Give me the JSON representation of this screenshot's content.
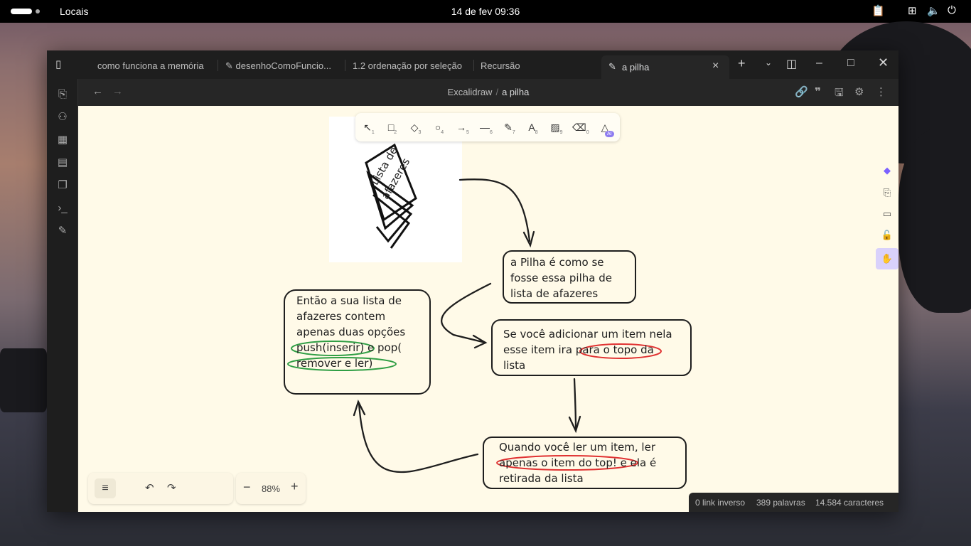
{
  "system": {
    "places": "Locais",
    "clock": "14 de fev  09:36"
  },
  "tabs": [
    {
      "label": "como funciona a memória",
      "icon": "file-icon"
    },
    {
      "label": "desenhoComoFuncio...",
      "icon": "excalidraw-icon"
    },
    {
      "label": "1.2 ordenação por seleção",
      "icon": "file-icon"
    },
    {
      "label": "Recursão",
      "icon": "file-icon"
    }
  ],
  "active_tab": {
    "label": "a pilha",
    "icon": "excalidraw-icon"
  },
  "breadcrumb": {
    "parent": "Excalidraw",
    "separator": "/",
    "current": "a pilha"
  },
  "drawing": {
    "image_caption_line1": "Lista de",
    "image_caption_line2": "afazeres",
    "box_top": [
      "a Pilha é como se",
      "fosse essa pilha de",
      "lista de afazeres"
    ],
    "box_left": [
      "Então a sua lista de",
      "afazeres contem",
      "apenas duas opções",
      "push(inserir) e pop(",
      "remover e ler)"
    ],
    "box_mid": [
      "Se você adicionar um item nela",
      "esse item ira para o topo da",
      "lista"
    ],
    "box_bottom": [
      "Quando você ler um item, ler",
      "apenas o item do top! e ela é",
      "retirada da lista"
    ],
    "colors": {
      "ink": "#1e1e1e",
      "green": "#2f9e44",
      "red": "#e03131"
    }
  },
  "zoom": {
    "value": "88%"
  },
  "status": {
    "backlinks": "0 link inverso",
    "words": "389 palavras",
    "chars": "14.584 caracteres"
  }
}
